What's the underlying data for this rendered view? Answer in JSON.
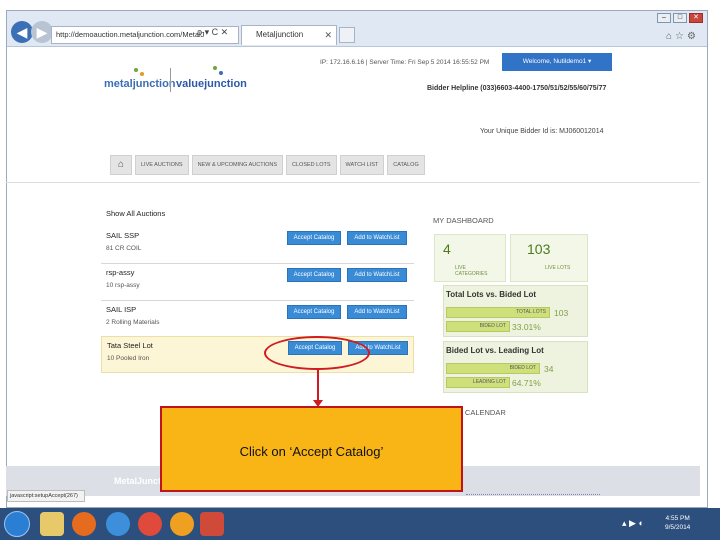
{
  "browser": {
    "address": "http://demoauction.metaljunction.com/MetalJ",
    "address_tools": "ρ ▾ C ✕",
    "tab_label": "Metaljunction",
    "tab_close": "✕",
    "window_controls": [
      "–",
      "□",
      "✕"
    ]
  },
  "header": {
    "logo_metal": "metaljunction",
    "logo_value": "valuejunction",
    "ip_line": "IP: 172.16.6.16 | Server Time: Fri Sep 5 2014 16:55:52 PM",
    "welcome": "Welcome, Nutildemo1 ▾",
    "helpline": "Bidder Helpline (033)6603-4400-1750/51/52/55/60/75/77",
    "bidder_id": "Your Unique Bidder Id is: MJ060012014"
  },
  "menu": {
    "home_icon": "⌂",
    "items": [
      "LIVE AUCTIONS",
      "NEW & UPCOMING AUCTIONS",
      "CLOSED LOTS",
      "WATCH LIST",
      "CATALOG"
    ]
  },
  "auctions": {
    "show_all": "Show All Auctions",
    "accept_label": "Accept Catalog",
    "watch_label": "Add to WatchList",
    "rows": [
      {
        "name": "SAIL SSP",
        "sub": "81 CR COIL"
      },
      {
        "name": "rsp-assy",
        "sub": "10 rsp-assy"
      },
      {
        "name": "SAIL ISP",
        "sub": "2 Rolling Materials"
      },
      {
        "name": "Tata Steel Lot",
        "sub": "10 Pooled Iron"
      }
    ]
  },
  "dashboard": {
    "title": "MY DASHBOARD",
    "live_categories_count": "4",
    "live_categories_label": "LIVE CATEGORIES",
    "live_lots_count": "103",
    "live_lots_label": "LIVE LOTS",
    "total_vs_bided": {
      "heading": "Total Lots vs. Bided Lot",
      "total_label": "TOTAL LOTS",
      "total_value": "103",
      "bided_label": "BIDED LOT",
      "bided_value": "33.01%",
      "bided_fraction": 0.3301
    },
    "bided_vs_leading": {
      "heading": "Bided Lot vs. Leading Lot",
      "bided_label": "BIDED LOT",
      "bided_value": "34",
      "leading_label": "LEADING LOT",
      "leading_value": "64.71%",
      "leading_fraction": 0.6471
    },
    "calendar": "G CALENDAR"
  },
  "callout": {
    "text": "Click on ‘Accept Catalog’"
  },
  "footer": {
    "logo": "MetalJunct",
    "status_url": "javascript:setupAccept(267)"
  },
  "taskbar": {
    "tray": "▴ ▶ ◐",
    "time": "4:55 PM",
    "date": "9/5/2014"
  },
  "colors": {
    "accent_blue": "#3a8bd6",
    "callout_fill": "#f9b515",
    "callout_border": "#c0141b",
    "dashboard_green": "#cfe07a"
  }
}
